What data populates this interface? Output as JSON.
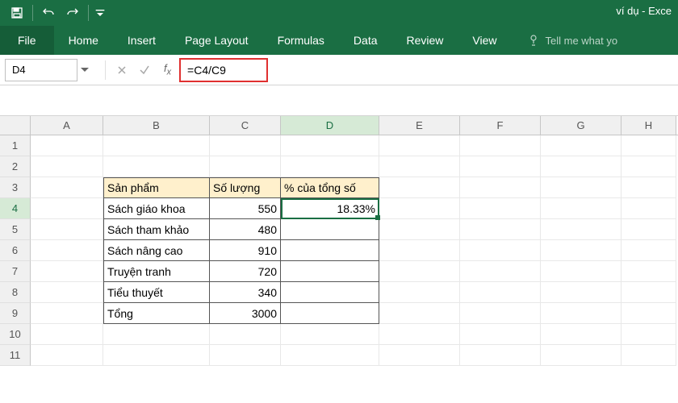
{
  "window": {
    "title": "ví dụ - Exce"
  },
  "ribbon": {
    "file": "File",
    "tabs": [
      "Home",
      "Insert",
      "Page Layout",
      "Formulas",
      "Data",
      "Review",
      "View"
    ],
    "tell_me": "Tell me what yo"
  },
  "formula_bar": {
    "name_box": "D4",
    "formula": "=C4/C9"
  },
  "columns": [
    "A",
    "B",
    "C",
    "D",
    "E",
    "F",
    "G",
    "H"
  ],
  "rows": [
    "1",
    "2",
    "3",
    "4",
    "5",
    "6",
    "7",
    "8",
    "9",
    "10",
    "11"
  ],
  "table": {
    "headers": {
      "b": "Sản phẩm",
      "c": "Số lượng",
      "d": "% của tổng số"
    },
    "rows": [
      {
        "b": "Sách giáo khoa",
        "c": "550",
        "d": "18.33%"
      },
      {
        "b": "Sách tham khảo",
        "c": "480",
        "d": ""
      },
      {
        "b": "Sách nâng cao",
        "c": "910",
        "d": ""
      },
      {
        "b": "Truyện tranh",
        "c": "720",
        "d": ""
      },
      {
        "b": "Tiểu thuyết",
        "c": "340",
        "d": ""
      },
      {
        "b": "Tổng",
        "c": "3000",
        "d": ""
      }
    ]
  },
  "active_cell": {
    "col": "D",
    "row": 4
  },
  "chart_data": {
    "type": "table",
    "title": "% của tổng số",
    "categories": [
      "Sách giáo khoa",
      "Sách tham khảo",
      "Sách nâng cao",
      "Truyện tranh",
      "Tiểu thuyết"
    ],
    "values": [
      550,
      480,
      910,
      720,
      340
    ],
    "total": 3000,
    "percent": [
      18.33
    ]
  }
}
